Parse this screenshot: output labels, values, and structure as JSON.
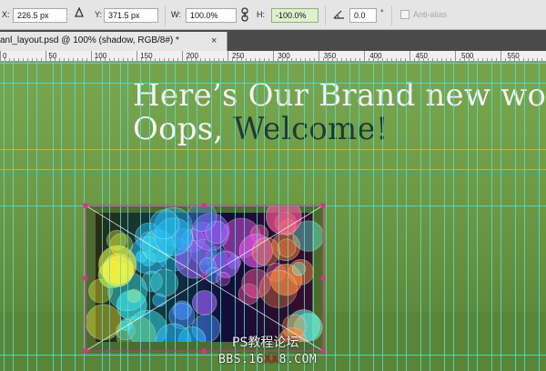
{
  "options_bar": {
    "x_label": "X:",
    "x_value": "226.5 px",
    "delta_icon": "reference-point-triangle-icon",
    "y_label": "Y:",
    "y_value": "371.5 px",
    "w_label": "W:",
    "w_value": "100.0%",
    "link_icon": "chain-link-icon",
    "h_label": "H:",
    "h_value": "-100.0%",
    "angle_icon": "rotate-angle-icon",
    "angle_value": "0.0",
    "degree_symbol": "°",
    "antialias_label": "Anti-alias"
  },
  "document_tab": {
    "title": "anl_layout.psd @ 100% (shadow, RGB/8#) *",
    "close_glyph": "×"
  },
  "ruler": {
    "labels": [
      "0",
      "50",
      "100",
      "150",
      "200",
      "250",
      "300",
      "350",
      "400",
      "450",
      "500",
      "550"
    ]
  },
  "canvas": {
    "headline_line1": "Here’s Our Brand new wo",
    "headline_line2_part1": "Oops, ",
    "headline_line2_part2": "Welcome!",
    "watermark_line1": "PS教程论坛",
    "watermark_line2_a": "BBS.16",
    "watermark_line2_b": "XX",
    "watermark_line2_c": "8.COM"
  },
  "colors": {
    "canvas_green": "#6e9a45",
    "guide_cyan": "#4fe3d8",
    "transform_handle": "#d6338a",
    "headline_white": "#f3f3f3",
    "headline_dark": "#1e3a37",
    "watermark_red": "#e0151b"
  }
}
